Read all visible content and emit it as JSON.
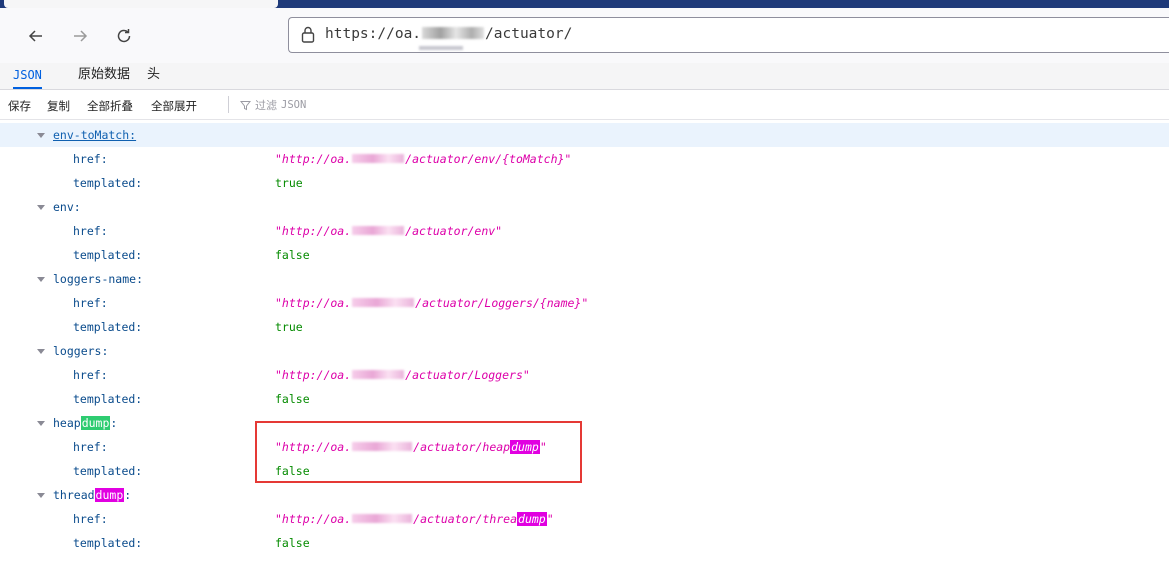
{
  "browser": {
    "url_prefix": "https://oa.",
    "url_suffix": "/actuator/"
  },
  "viewer_tabs": [
    "JSON",
    "原始数据",
    "头"
  ],
  "actions": {
    "save": "保存",
    "copy": "复制",
    "collapse_all": "全部折叠",
    "expand_all": "全部展开",
    "filter_prefix": "过滤",
    "filter_mono": "JSON"
  },
  "tree": {
    "env_tomatch": {
      "key": "env-toMatch:",
      "href_label": "href:",
      "href_prefix": "\"http://oa.",
      "href_suffix": "/actuator/env/{toMatch}\"",
      "templated_label": "templated:",
      "templated": "true"
    },
    "env": {
      "key": "env:",
      "href_label": "href:",
      "href_prefix": "\"http://oa.",
      "href_suffix": "/actuator/env\"",
      "templated_label": "templated:",
      "templated": "false"
    },
    "loggers_name": {
      "key": "loggers-name:",
      "href_label": "href:",
      "href_prefix": "\"http://oa.",
      "href_suffix": "/actuator/Loggers/{name}\"",
      "templated_label": "templated:",
      "templated": "true"
    },
    "loggers": {
      "key": "loggers:",
      "href_label": "href:",
      "href_prefix": "\"http://oa.",
      "href_suffix": "/actuator/Loggers\"",
      "templated_label": "templated:",
      "templated": "false"
    },
    "heapdump": {
      "key_a": "heap",
      "key_hl": "dump",
      "key_b": ":",
      "href_label": "href:",
      "href_prefix": "\"http://oa.",
      "href_mid": "/actuator/heap",
      "href_hl": "dump",
      "href_end": "\"",
      "templated_label": "templated:",
      "templated": "false"
    },
    "threaddump": {
      "key_a": "thread",
      "key_hl": "dump",
      "key_b": ":",
      "href_label": "href:",
      "href_prefix": "\"http://oa.",
      "href_mid": "/actuator/threa",
      "href_hl": "dump",
      "href_end": "\"",
      "templated_label": "templated:",
      "templated": "false"
    }
  },
  "colors": {
    "string": "#dd00a9",
    "boolean": "#058b00",
    "key": "#0a4b8c",
    "highlight_box": "#e53935",
    "match_green": "#2ecc71",
    "match_magenta": "#e100e1"
  }
}
